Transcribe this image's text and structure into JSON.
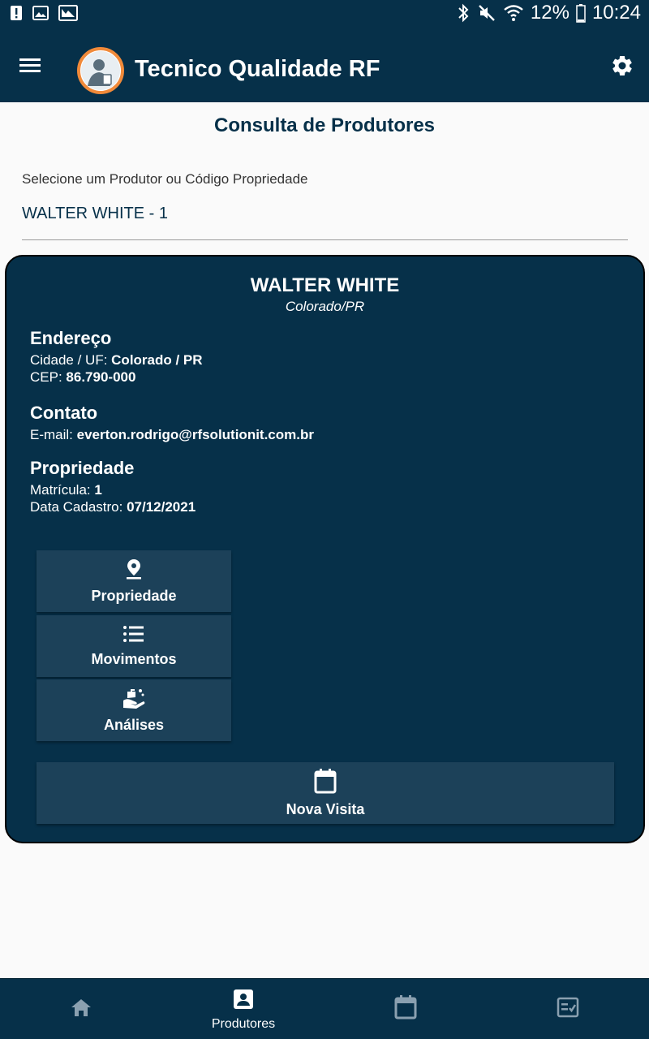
{
  "status_bar": {
    "battery": "12%",
    "time": "10:24"
  },
  "app_bar": {
    "title": "Tecnico Qualidade RF"
  },
  "page": {
    "title": "Consulta de Produtores",
    "select_label": "Selecione um Produtor ou Código Propriedade",
    "select_value": "WALTER WHITE - 1"
  },
  "producer": {
    "name": "WALTER WHITE",
    "location": "Colorado/PR",
    "address_heading": "Endereço",
    "city_label": "Cidade / UF: ",
    "city_value": "Colorado / PR",
    "cep_label": "CEP: ",
    "cep_value": "86.790-000",
    "contact_heading": "Contato",
    "email_label": "E-mail: ",
    "email_value": "everton.rodrigo@rfsolutionit.com.br",
    "property_heading": "Propriedade",
    "registration_label": "Matrícula: ",
    "registration_value": "1",
    "date_label": "Data Cadastro: ",
    "date_value": "07/12/2021"
  },
  "actions": {
    "property": "Propriedade",
    "movements": "Movimentos",
    "analyses": "Análises",
    "new_visit": "Nova Visita"
  },
  "bottom_nav": {
    "producers": "Produtores"
  },
  "colors": {
    "primary": "#063049",
    "button": "#1c4159",
    "accent": "#f08a3a",
    "nav_inactive": "#8aa0b0"
  }
}
